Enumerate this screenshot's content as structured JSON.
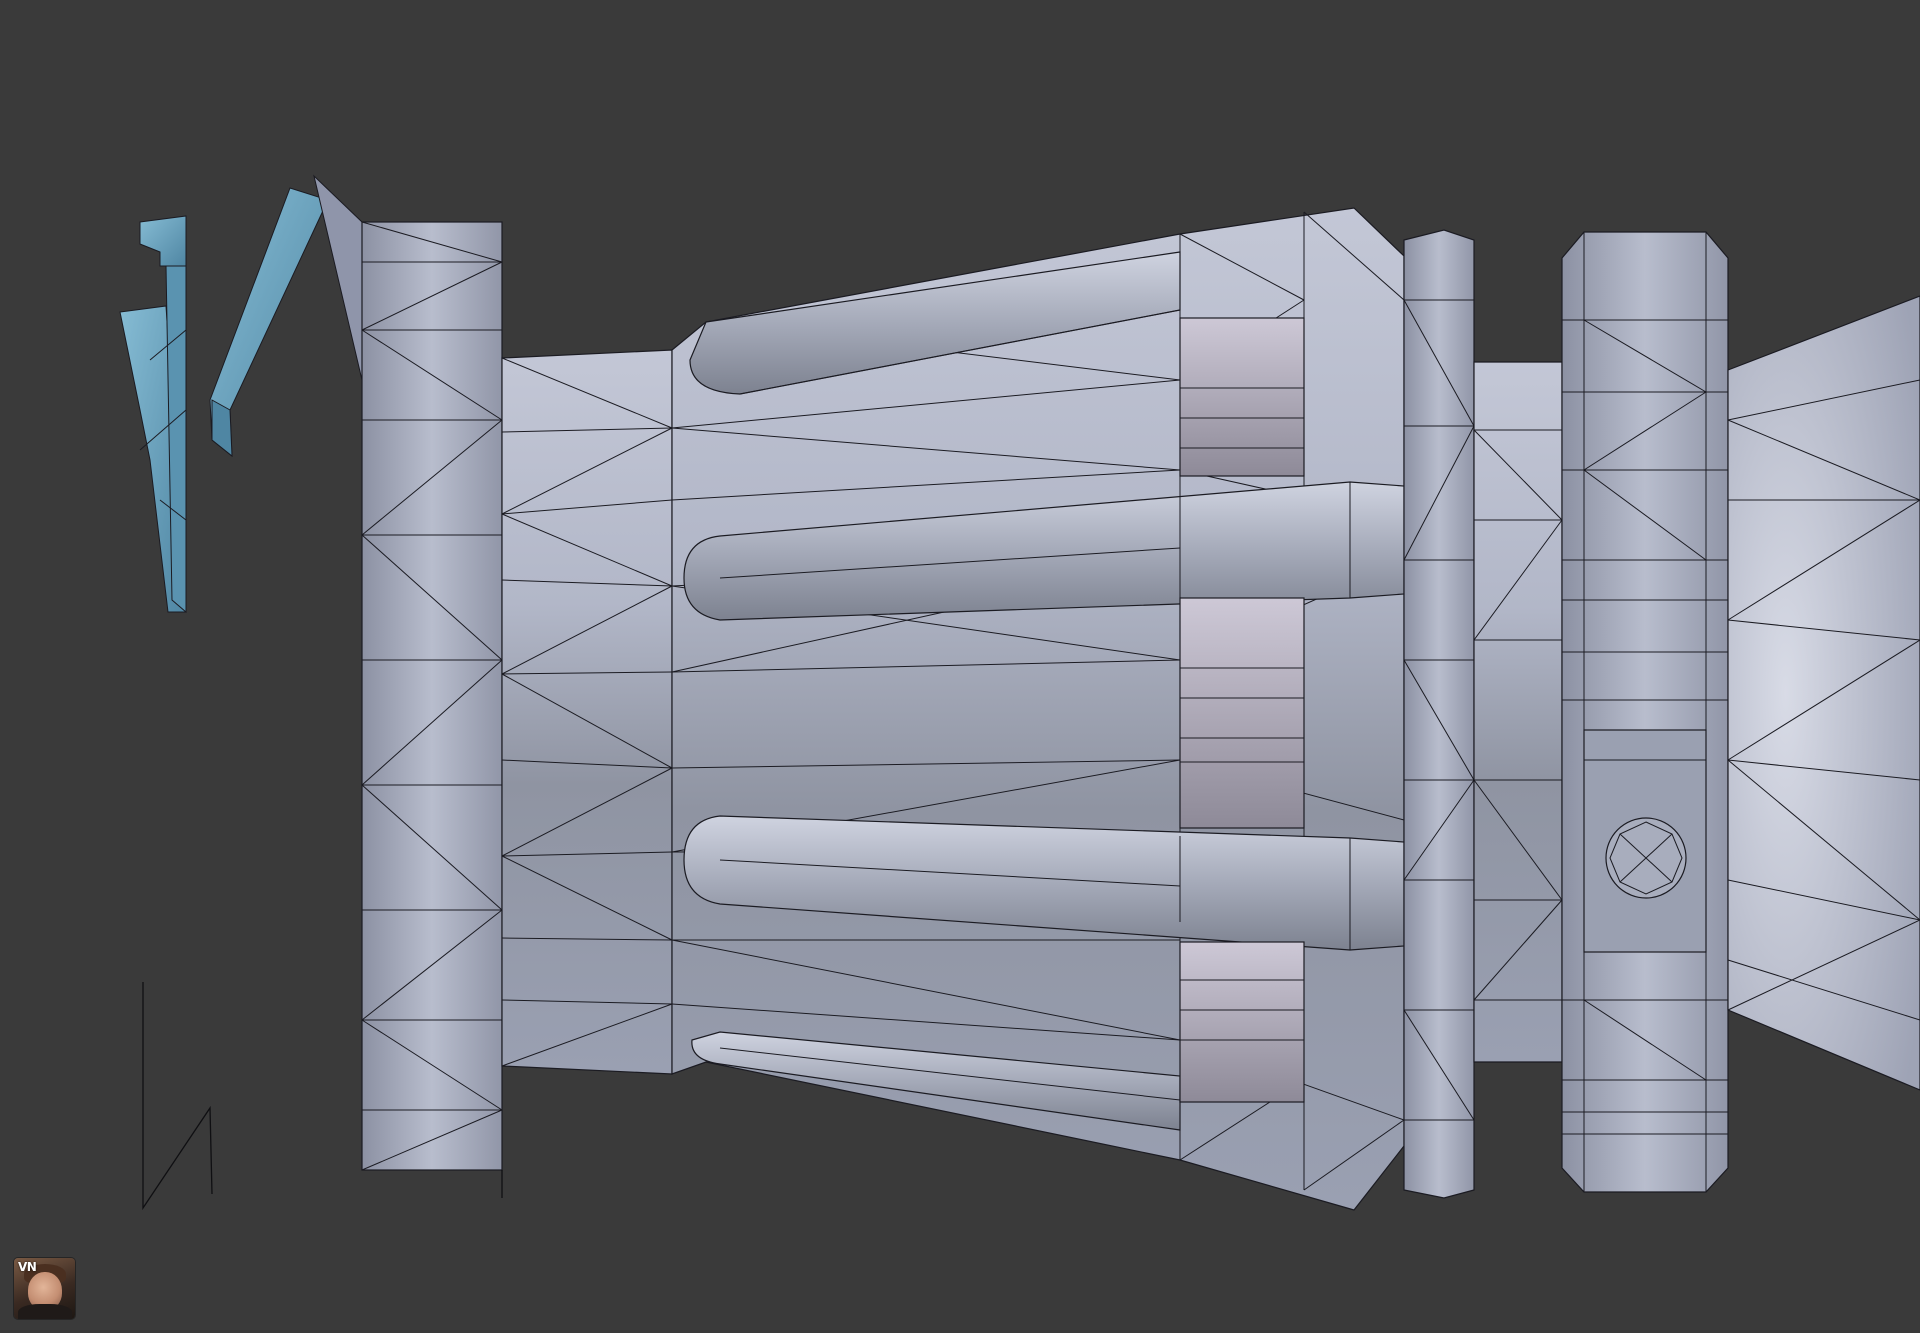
{
  "viewport": {
    "background_color": "#3a3a3a",
    "mesh_color": "#a9afc4",
    "selected_color": "#6aa3c0",
    "wire_color": "#141418"
  },
  "avatar": {
    "initials": "VN",
    "icon": "user-avatar"
  }
}
